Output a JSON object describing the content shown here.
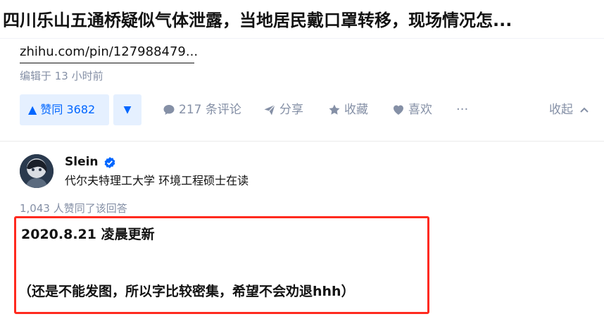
{
  "question": {
    "title": "四川乐山五通桥疑似气体泄露，当地居民戴口罩转移，现场情况怎..."
  },
  "previous_answer": {
    "link_text": "zhihu.com/pin/127988479...",
    "edited": "编辑于 13 小时前",
    "actions": {
      "upvote_label": "▲ 赞同 3682",
      "downvote_label": "▼",
      "comments_label": "217 条评论",
      "share_label": "分享",
      "favorite_label": "收藏",
      "like_label": "喜欢",
      "more_label": "···",
      "collapse_label": "收起"
    }
  },
  "answer": {
    "author_name": "Slein",
    "author_headline": "代尔夫特理工大学 环境工程硕士在读",
    "vote_count_text": "1,043 人赞同了该回答",
    "content": {
      "line1": "2020.8.21 凌晨更新",
      "line2": "（还是不能发图，所以字比较密集，希望不会劝退hhh）"
    }
  },
  "colors": {
    "accent": "#0066ff",
    "accent_bg": "#e5f0ff",
    "muted": "#8590a6",
    "highlight_box": "#ff2a1f"
  }
}
